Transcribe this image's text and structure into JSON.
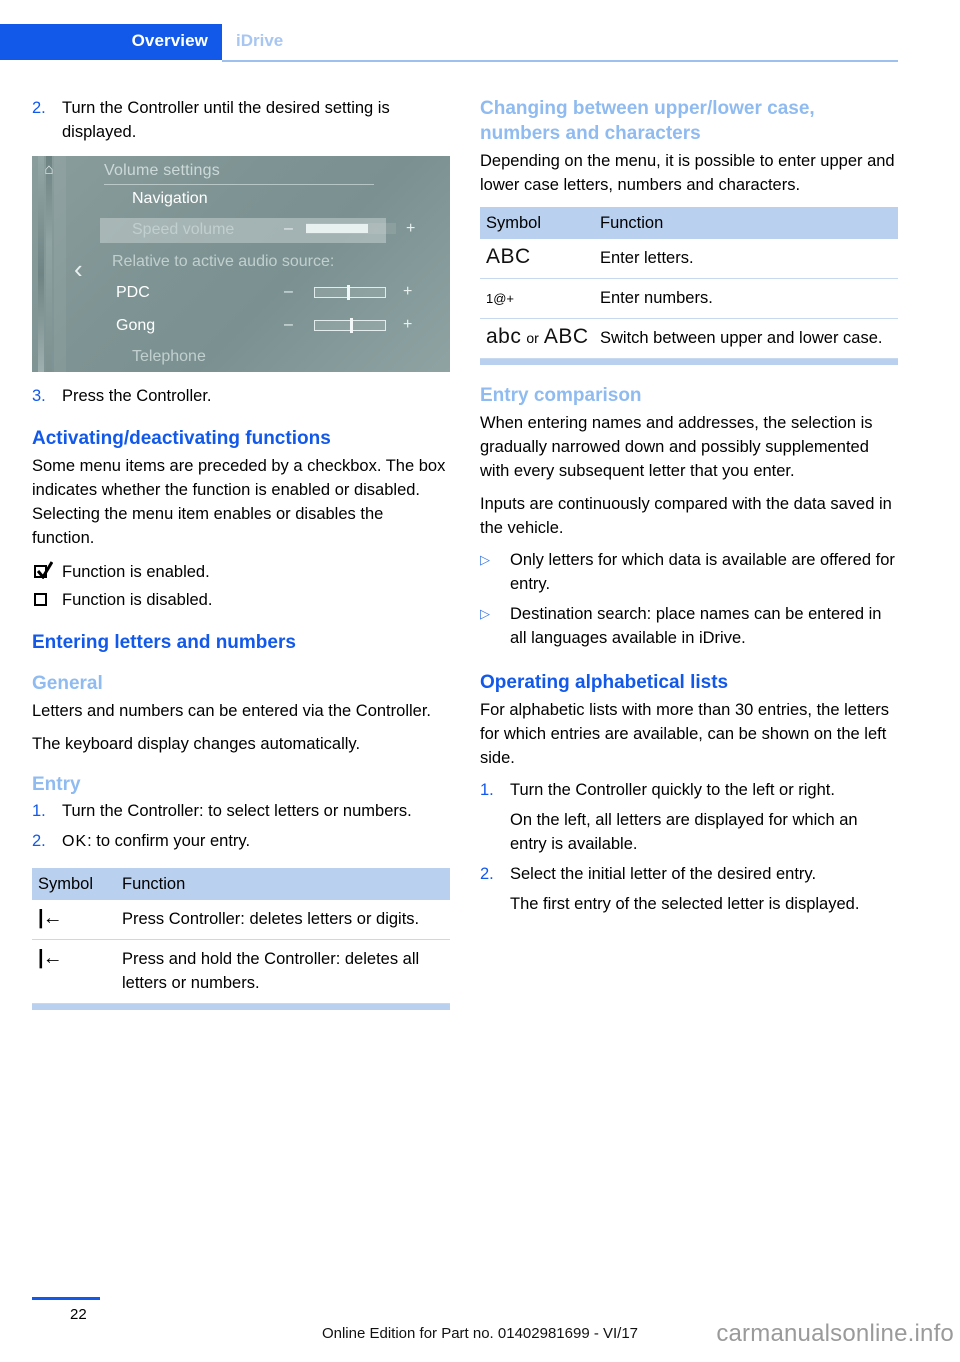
{
  "header": {
    "active_tab": "Overview",
    "inactive_tab": "iDrive",
    "accent_color": "#1259ea",
    "inactive_color": "#a8c6f2"
  },
  "left_column": {
    "step2": {
      "num": "2.",
      "text": "Turn the Controller until the desired setting is displayed."
    },
    "screenshot": {
      "title": "Volume settings",
      "home_icon": "home-icon",
      "back_icon": "chevron-left-icon",
      "items": [
        {
          "label": "Navigation",
          "dim": false
        },
        {
          "label": "Speed volume",
          "dim": true
        },
        {
          "label": "Relative to active audio source:",
          "dim": true
        },
        {
          "label": "PDC",
          "dim": false
        },
        {
          "label": "Gong",
          "dim": false
        },
        {
          "label": "Telephone",
          "dim": true
        }
      ],
      "minus": "–",
      "plus": "+"
    },
    "step3": {
      "num": "3.",
      "text": "Press the Controller."
    },
    "heading_activating": "Activating/deactivating functions",
    "activating_body": "Some menu items are preceded by a checkbox. The box indicates whether the function is enabled or disabled. Selecting the menu item enables or disables the function.",
    "checkbox_rows": [
      {
        "icon": "checkbox-checked-icon",
        "text": "Function is enabled."
      },
      {
        "icon": "checkbox-unchecked-icon",
        "text": "Function is disabled."
      }
    ],
    "heading_entering": "Entering letters and numbers",
    "heading_general": "General",
    "general_p1": "Letters and numbers can be entered via the Controller.",
    "general_p2": "The keyboard display changes automatically.",
    "heading_entry": "Entry",
    "entry_steps": [
      {
        "num": "1.",
        "text": "Turn the Controller: to select letters or numbers."
      },
      {
        "num": "2.",
        "symbol": "OK",
        "text": ": to confirm your entry."
      }
    ],
    "table": {
      "headers": [
        "Symbol",
        "Function"
      ],
      "rows": [
        {
          "symbol": "|←",
          "symbol_name": "backspace-icon",
          "function": "Press Controller: deletes letters or digits."
        },
        {
          "symbol": "|←",
          "symbol_name": "backspace-icon",
          "function": "Press and hold the Controller: deletes all letters or numbers."
        }
      ]
    }
  },
  "right_column": {
    "heading_changing": "Changing between upper/lower case, numbers and characters",
    "changing_body": "Depending on the menu, it is possible to enter upper and lower case letters, numbers and characters.",
    "table": {
      "headers": [
        "Symbol",
        "Function"
      ],
      "rows": [
        {
          "symbol": "ABC",
          "function": "Enter letters."
        },
        {
          "symbol": "1@+",
          "function": "Enter numbers."
        },
        {
          "symbol_a": "abc",
          "symbol_or": "or",
          "symbol_b": "ABC",
          "function": "Switch between upper and lower case."
        }
      ]
    },
    "heading_entry_comparison": "Entry comparison",
    "entry_comparison_p1": "When entering names and addresses, the selection is gradually narrowed down and possibly supplemented with every subsequent letter that you enter.",
    "entry_comparison_p2": "Inputs are continuously compared with the data saved in the vehicle.",
    "bullets": [
      {
        "mark": "▷",
        "text": "Only letters for which data is available are offered for entry."
      },
      {
        "mark": "▷",
        "text": "Destination search: place names can be entered in all languages available in iDrive."
      }
    ],
    "heading_operating_lists": "Operating alphabetical lists",
    "operating_body": "For alphabetic lists with more than 30 entries, the letters for which entries are available, can be shown on the left side.",
    "list_steps": [
      {
        "num": "1.",
        "text": "Turn the Controller quickly to the left or right.",
        "sub": "On the left, all letters are displayed for which an entry is available."
      },
      {
        "num": "2.",
        "text": "Select the initial letter of the desired entry.",
        "sub": "The first entry of the selected letter is displayed."
      }
    ]
  },
  "footer": {
    "page_number": "22",
    "note": "Online Edition for Part no. 01402981699 - VI/17",
    "watermark": "carmanualsonline.info"
  }
}
